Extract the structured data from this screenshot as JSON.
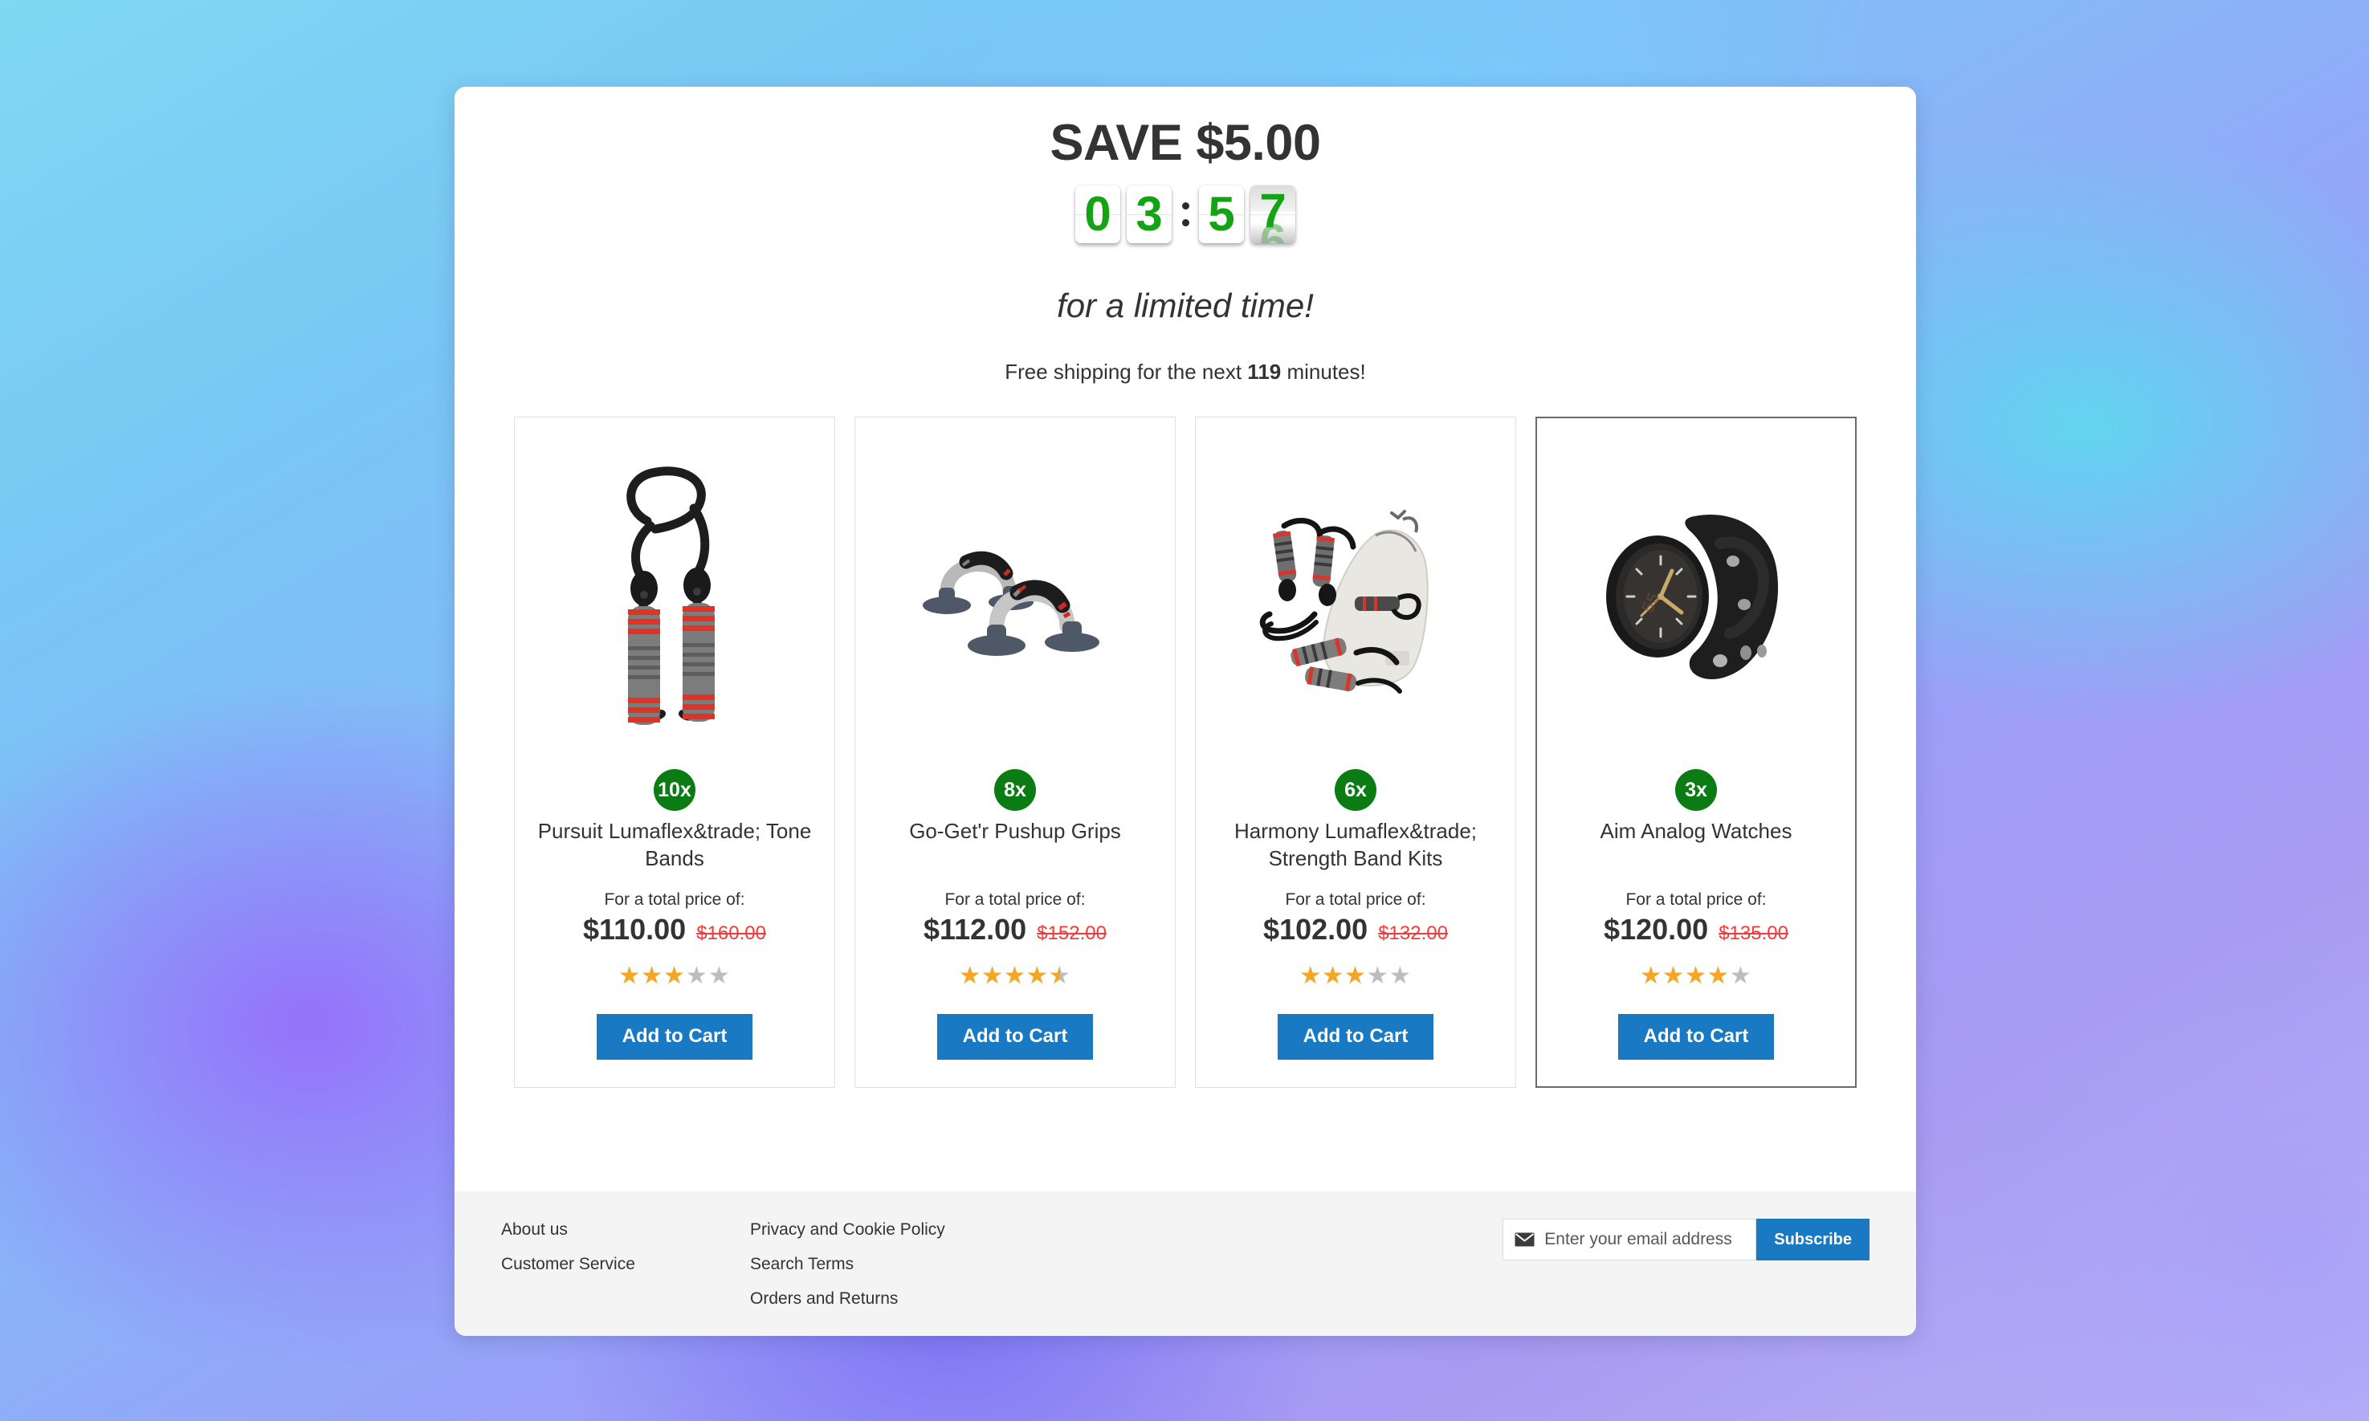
{
  "promo": {
    "save_title": "SAVE $5.00",
    "countdown": {
      "digits": [
        "0",
        "3",
        "5",
        "7"
      ],
      "flipping_index": 3,
      "ghost_digit": "6",
      "display": "03:57",
      "digit_color": "#13a313"
    },
    "limited_time_text": "for a limited time!",
    "free_shipping_prefix": "Free shipping for the next ",
    "free_shipping_minutes": "119",
    "free_shipping_suffix": " minutes!"
  },
  "products": [
    {
      "qty_badge": "10x",
      "name": "Pursuit Lumaflex&trade; Tone Bands",
      "price_label": "For a total price of:",
      "price_new": "$110.00",
      "price_old": "$160.00",
      "rating": 3,
      "rating_pct": "60%",
      "add_to_cart_label": "Add to Cart",
      "image": "resistance-band-image",
      "highlighted": false
    },
    {
      "qty_badge": "8x",
      "name": "Go-Get'r Pushup Grips",
      "price_label": "For a total price of:",
      "price_new": "$112.00",
      "price_old": "$152.00",
      "rating": 4.5,
      "rating_pct": "90%",
      "add_to_cart_label": "Add to Cart",
      "image": "pushup-grips-image",
      "highlighted": false
    },
    {
      "qty_badge": "6x",
      "name": "Harmony Lumaflex&trade; Strength Band Kits",
      "price_label": "For a total price of:",
      "price_new": "$102.00",
      "price_old": "$132.00",
      "rating": 3,
      "rating_pct": "60%",
      "add_to_cart_label": "Add to Cart",
      "image": "strength-band-kit-image",
      "highlighted": false
    },
    {
      "qty_badge": "3x",
      "name": "Aim Analog Watches",
      "price_label": "For a total price of:",
      "price_new": "$120.00",
      "price_old": "$135.00",
      "rating": 4,
      "rating_pct": "80%",
      "add_to_cart_label": "Add to Cart",
      "image": "analog-watch-image",
      "highlighted": true
    }
  ],
  "footer": {
    "column_one": [
      {
        "label": "About us"
      },
      {
        "label": "Customer Service"
      }
    ],
    "column_two": [
      {
        "label": "Privacy and Cookie Policy"
      },
      {
        "label": "Search Terms"
      },
      {
        "label": "Orders and Returns"
      }
    ],
    "newsletter": {
      "placeholder": "Enter your email address",
      "value": "",
      "subscribe_label": "Subscribe"
    }
  },
  "colors": {
    "accent_blue": "#1979c3",
    "badge_green": "#0a7c13",
    "timer_green": "#13a313",
    "old_price_red": "#f03c3c",
    "star_active": "#f6a623",
    "star_inactive": "#bdbdbd"
  }
}
